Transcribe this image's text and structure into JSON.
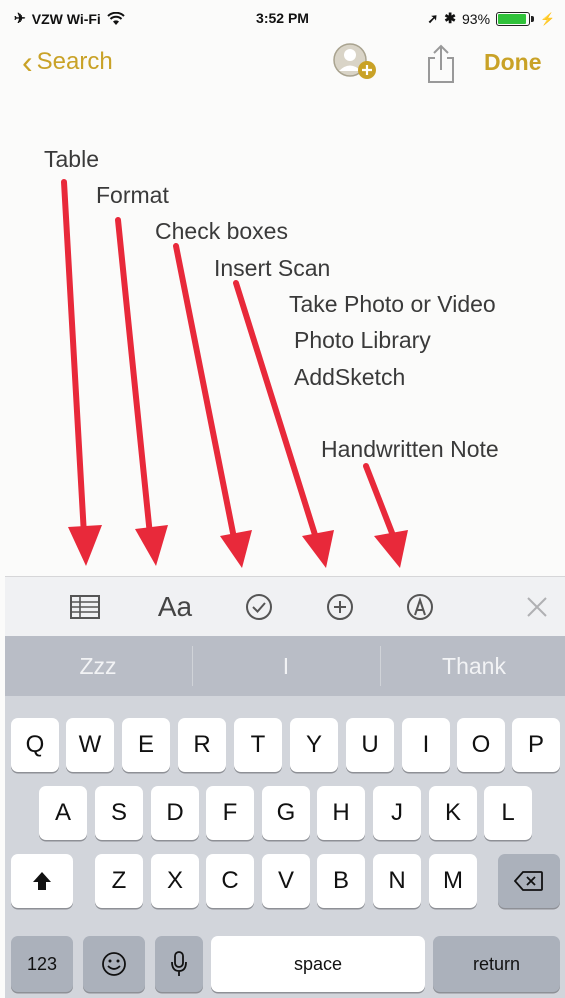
{
  "status": {
    "carrier": "VZW Wi-Fi",
    "time": "3:52 PM",
    "battery": "93%",
    "battery_level": 0.93
  },
  "nav": {
    "back_label": "Search",
    "done_label": "Done"
  },
  "annotations": [
    "Table",
    "Format",
    "Check boxes",
    "Insert Scan",
    "Take Photo or Video",
    "Photo Library",
    "AddSketch",
    "Handwritten Note"
  ],
  "toolbar": {
    "format_label": "Aa"
  },
  "suggestions": [
    "Zzz",
    "I",
    "Thank"
  ],
  "keys": {
    "row1": [
      "Q",
      "W",
      "E",
      "R",
      "T",
      "Y",
      "U",
      "I",
      "O",
      "P"
    ],
    "row2": [
      "A",
      "S",
      "D",
      "F",
      "G",
      "H",
      "J",
      "K",
      "L"
    ],
    "row3": [
      "Z",
      "X",
      "C",
      "V",
      "B",
      "N",
      "M"
    ],
    "numbers": "123",
    "space": "space",
    "return": "return"
  },
  "colors": {
    "accent": "#c9a227",
    "arrow": "#e8293a",
    "battery_fill": "#30c23a"
  }
}
